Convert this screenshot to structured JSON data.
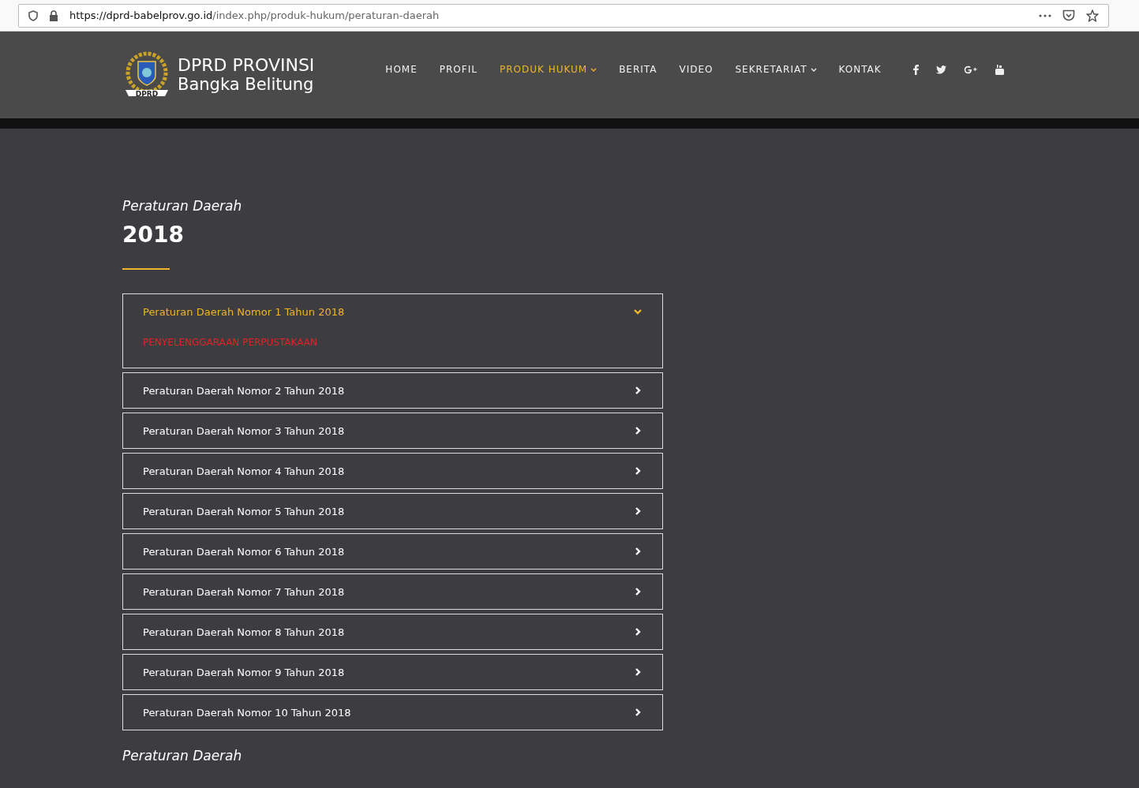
{
  "browser": {
    "url_host": "https://dprd-babelprov.go.id",
    "url_path": "/index.php/produk-hukum/peraturan-daerah"
  },
  "header": {
    "logo_line_1": "DPRD PROVINSI",
    "logo_line_2": "Bangka Belitung",
    "emblem_label": "DPRD",
    "nav": [
      {
        "label": "HOME",
        "selected": false,
        "dropdown": false
      },
      {
        "label": "PROFIL",
        "selected": false,
        "dropdown": false
      },
      {
        "label": "PRODUK HUKUM",
        "selected": true,
        "dropdown": true
      },
      {
        "label": "BERITA",
        "selected": false,
        "dropdown": false
      },
      {
        "label": "VIDEO",
        "selected": false,
        "dropdown": false
      },
      {
        "label": "SEKRETARIAT",
        "selected": false,
        "dropdown": true
      },
      {
        "label": "KONTAK",
        "selected": false,
        "dropdown": false
      }
    ],
    "social": [
      {
        "kind": "facebook"
      },
      {
        "kind": "twitter"
      },
      {
        "kind": "googleplus"
      },
      {
        "kind": "youtube"
      }
    ]
  },
  "section": {
    "subtitle": "Peraturan Daerah",
    "title": "2018",
    "items": [
      {
        "title": "Peraturan Daerah Nomor 1 Tahun 2018",
        "expanded": true,
        "content": "PENYELENGGARAAN PERPUSTAKAAN"
      },
      {
        "title": "Peraturan Daerah Nomor 2 Tahun 2018",
        "expanded": false
      },
      {
        "title": "Peraturan Daerah Nomor 3 Tahun 2018",
        "expanded": false
      },
      {
        "title": "Peraturan Daerah Nomor 4 Tahun 2018",
        "expanded": false
      },
      {
        "title": "Peraturan Daerah Nomor 5 Tahun 2018",
        "expanded": false
      },
      {
        "title": "Peraturan Daerah Nomor 6 Tahun 2018",
        "expanded": false
      },
      {
        "title": "Peraturan Daerah Nomor 7 Tahun 2018",
        "expanded": false
      },
      {
        "title": "Peraturan Daerah Nomor 8 Tahun 2018",
        "expanded": false
      },
      {
        "title": "Peraturan Daerah Nomor 9 Tahun 2018",
        "expanded": false
      },
      {
        "title": "Peraturan Daerah Nomor 10 Tahun 2018",
        "expanded": false
      }
    ]
  },
  "next_section": {
    "subtitle": "Peraturan Daerah"
  }
}
